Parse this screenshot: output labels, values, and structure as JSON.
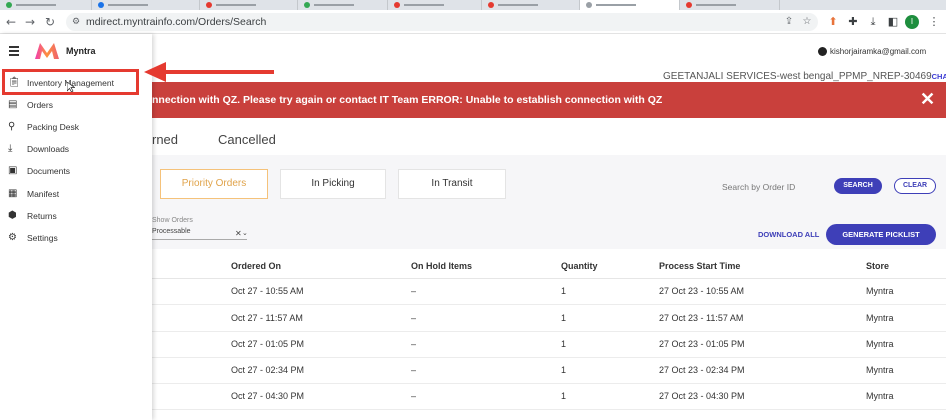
{
  "browser": {
    "url": "mdirect.myntrainfo.com/Orders/Search",
    "profile_initial": "I"
  },
  "header": {
    "brand": "Myntra",
    "user_email": "kishorjairamka@gmail.com",
    "account": "GEETANJALI SERVICES-west bengal_PPMP_NREP-30469",
    "change_label": "CHANGE"
  },
  "sidebar": {
    "items": [
      {
        "label": "Inventory Management",
        "icon": "clipboard-icon"
      },
      {
        "label": "Orders",
        "icon": "orders-icon"
      },
      {
        "label": "Packing Desk",
        "icon": "packing-icon"
      },
      {
        "label": "Downloads",
        "icon": "download-icon"
      },
      {
        "label": "Documents",
        "icon": "document-icon"
      },
      {
        "label": "Manifest",
        "icon": "manifest-icon"
      },
      {
        "label": "Returns",
        "icon": "returns-icon"
      },
      {
        "label": "Settings",
        "icon": "settings-icon"
      }
    ]
  },
  "error_banner": {
    "message": "nnection with QZ. Please try again or contact IT Team ERROR: Unable to establish connection with QZ",
    "close": "✕"
  },
  "status_tabs": [
    "rned",
    "Cancelled"
  ],
  "sub_tabs": [
    "Priority Orders",
    "In Picking",
    "In Transit"
  ],
  "filters": {
    "search_placeholder": "Search by Order ID",
    "search_button": "SEARCH",
    "clear_button": "CLEAR",
    "show_orders_label": "Show Orders",
    "show_orders_value": "Processable",
    "download_all": "DOWNLOAD ALL",
    "generate_picklist": "GENERATE PICKLIST"
  },
  "table": {
    "columns": [
      "Ordered On",
      "On Hold Items",
      "Quantity",
      "Process Start Time",
      "Store"
    ],
    "rows": [
      [
        "Oct 27 - 10:55 AM",
        "–",
        "1",
        "27 Oct 23 - 10:55 AM",
        "Myntra"
      ],
      [
        "Oct 27 - 11:57 AM",
        "–",
        "1",
        "27 Oct 23 - 11:57 AM",
        "Myntra"
      ],
      [
        "Oct 27 - 01:05 PM",
        "–",
        "1",
        "27 Oct 23 - 01:05 PM",
        "Myntra"
      ],
      [
        "Oct 27 - 02:34 PM",
        "–",
        "1",
        "27 Oct 23 - 02:34 PM",
        "Myntra"
      ],
      [
        "Oct 27 - 04:30 PM",
        "–",
        "1",
        "27 Oct 23 - 04:30 PM",
        "Myntra"
      ]
    ]
  },
  "colors": {
    "accent": "#3e3fb8",
    "error": "#c9403c",
    "annotation": "#e53a30",
    "active_tab": "#e0a34a"
  }
}
